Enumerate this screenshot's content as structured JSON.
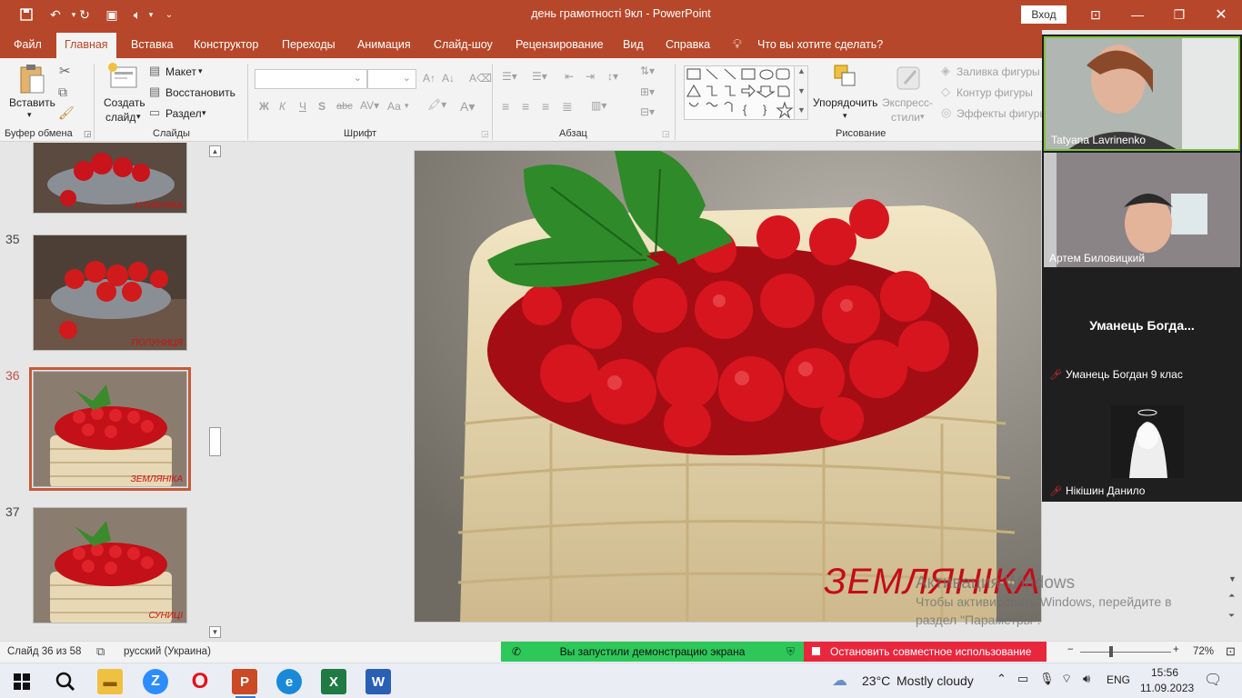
{
  "window": {
    "title": "день грамотності 9кл - PowerPoint",
    "login_label": "Вход"
  },
  "tabs": [
    "Файл",
    "Главная",
    "Вставка",
    "Конструктор",
    "Переходы",
    "Анимация",
    "Слайд-шоу",
    "Рецензирование",
    "Вид",
    "Справка",
    "Что вы хотите сделать?"
  ],
  "ribbon": {
    "paste": "Вставить",
    "group_clipboard": "Буфер обмена",
    "new_slide_1": "Создать",
    "new_slide_2": "слайд",
    "layout": "Макет",
    "reset": "Восстановить",
    "section": "Раздел",
    "group_slides": "Слайды",
    "group_font": "Шрифт",
    "bold": "Ж",
    "italic": "К",
    "underline": "Ч",
    "strike": "abc",
    "case": "Аа",
    "group_paragraph": "Абзац",
    "arrange": "Упорядочить",
    "quick_styles_1": "Экспресс-",
    "quick_styles_2": "стили",
    "shape_fill": "Заливка фигуры",
    "shape_outline": "Контур фигуры",
    "shape_effects": "Эффекты фигуры",
    "group_drawing": "Рисование"
  },
  "thumbnails": [
    {
      "number": "",
      "caption": "КЛУБНИКА"
    },
    {
      "number": "35",
      "caption": "ПОЛУНИЦЯ"
    },
    {
      "number": "36",
      "caption": "ЗЕМЛЯНІКА",
      "selected": true
    },
    {
      "number": "37",
      "caption": "СУНИЦІ"
    }
  ],
  "slide": {
    "title": "ЗЕМЛЯНІКА"
  },
  "activation": {
    "line1": "Активация Windows",
    "line2": "Чтобы активировать Windows, перейдите в",
    "line3": "раздел \"Параметры\"."
  },
  "participants": [
    {
      "name": "Tatyana Lavrinenko",
      "muted": false
    },
    {
      "name": "Артем Биловицкий",
      "muted": false
    },
    {
      "name": "Уманець Богдан 9 клас",
      "display": "Уманець  Богда...",
      "muted": true
    },
    {
      "name": "Нікішин Данило",
      "muted": true
    }
  ],
  "status": {
    "slide": "Слайд 36 из 58",
    "language": "русский (Украина)",
    "zoom": "72%",
    "zoom_level": 72
  },
  "share": {
    "started": "Вы запустили демонстрацию экрана",
    "stop": "Остановить совместное использование"
  },
  "taskbar": {
    "weather_temp": "23°C",
    "weather_text": "Mostly cloudy",
    "lang": "ENG",
    "time": "15:56",
    "date": "11.09.2023"
  },
  "colors": {
    "accent": "#b7472a",
    "share_green": "#2ec75a",
    "share_red": "#e8273d",
    "title_red": "#c40c18"
  }
}
